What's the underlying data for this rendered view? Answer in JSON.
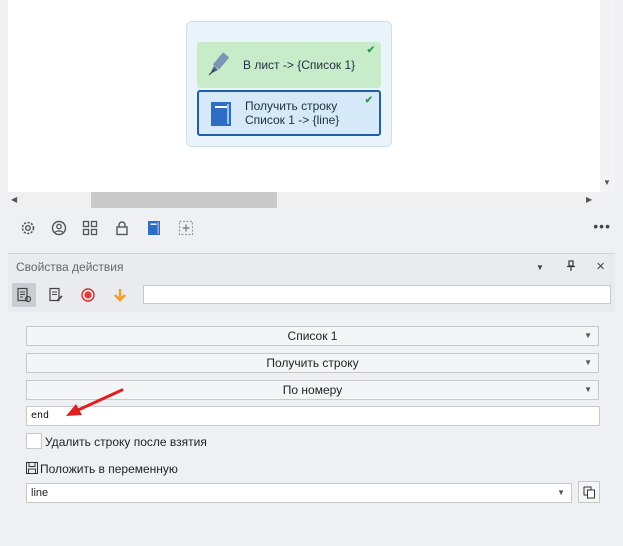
{
  "canvas": {
    "nodes": [
      {
        "label_line1": "В лист -> {Список 1}",
        "label_line2": "",
        "status": "ok"
      },
      {
        "label_line1": "Получить строку",
        "label_line2": "Список 1 -> {line}",
        "status": "ok"
      }
    ],
    "check_glyph": "✔"
  },
  "toolbar": {
    "icons": [
      "gear-icon",
      "user-circle-icon",
      "grid-icon",
      "lock-icon",
      "notebook-icon",
      "add-box-icon"
    ],
    "more_label": "•••"
  },
  "panel": {
    "title": "Свойства действия",
    "header_buttons": {
      "dropdown": "▼",
      "pin": "📌",
      "close": "✕"
    },
    "tools": [
      "action-properties-icon",
      "edit-properties-icon",
      "record-icon",
      "download-arrow-icon"
    ],
    "search_value": ""
  },
  "form": {
    "list_select": "Список 1",
    "operation_select": "Получить строку",
    "mode_select": "По номеру",
    "number_input": "end",
    "delete_after_take_checked": false,
    "delete_after_take_label": "Удалить строку после взятия",
    "save_to_variable_label": "Положить в переменную",
    "variable_value": "line"
  },
  "colors": {
    "node_green": "#c8ecc9",
    "node_blue": "#d5e9f8",
    "selected_border": "#1f5fa8",
    "annotation_arrow": "#e02020"
  }
}
